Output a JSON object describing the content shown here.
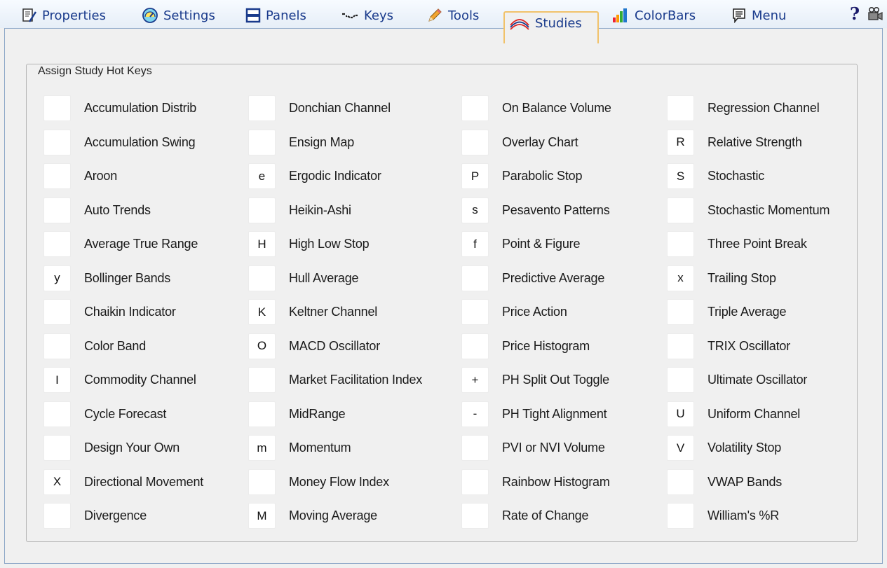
{
  "toolbar": {
    "tabs": [
      {
        "id": "properties",
        "label": "Properties",
        "icon": "properties-icon"
      },
      {
        "id": "settings",
        "label": "Settings",
        "icon": "settings-icon"
      },
      {
        "id": "panels",
        "label": "Panels",
        "icon": "panels-icon"
      },
      {
        "id": "keys",
        "label": "Keys",
        "icon": "keys-icon"
      },
      {
        "id": "tools",
        "label": "Tools",
        "icon": "pencil-icon"
      },
      {
        "id": "studies",
        "label": "Studies",
        "icon": "studies-icon",
        "active": true
      },
      {
        "id": "colorbars",
        "label": "ColorBars",
        "icon": "bar-chart-icon"
      },
      {
        "id": "menu",
        "label": "Menu",
        "icon": "menu-icon"
      }
    ],
    "help_label": "?",
    "accent": "#1a3b8c",
    "active_border": "#f1c26a"
  },
  "group": {
    "title": "Assign Study Hot Keys"
  },
  "columns": [
    [
      {
        "key": "",
        "label": "Accumulation Distrib"
      },
      {
        "key": "",
        "label": "Accumulation Swing"
      },
      {
        "key": "",
        "label": "Aroon"
      },
      {
        "key": "",
        "label": "Auto Trends"
      },
      {
        "key": "",
        "label": "Average True Range"
      },
      {
        "key": "y",
        "label": "Bollinger Bands"
      },
      {
        "key": "",
        "label": "Chaikin Indicator"
      },
      {
        "key": "",
        "label": "Color Band"
      },
      {
        "key": "I",
        "label": "Commodity Channel"
      },
      {
        "key": "",
        "label": "Cycle Forecast"
      },
      {
        "key": "",
        "label": "Design Your Own"
      },
      {
        "key": "X",
        "label": "Directional Movement"
      },
      {
        "key": "",
        "label": "Divergence"
      }
    ],
    [
      {
        "key": "",
        "label": "Donchian Channel"
      },
      {
        "key": "",
        "label": "Ensign Map"
      },
      {
        "key": "e",
        "label": "Ergodic Indicator"
      },
      {
        "key": "",
        "label": "Heikin-Ashi"
      },
      {
        "key": "H",
        "label": "High Low Stop"
      },
      {
        "key": "",
        "label": "Hull Average"
      },
      {
        "key": "K",
        "label": "Keltner Channel"
      },
      {
        "key": "O",
        "label": "MACD Oscillator"
      },
      {
        "key": "",
        "label": "Market Facilitation Index"
      },
      {
        "key": "",
        "label": "MidRange"
      },
      {
        "key": "m",
        "label": "Momentum"
      },
      {
        "key": "",
        "label": "Money Flow Index"
      },
      {
        "key": "M",
        "label": "Moving Average"
      }
    ],
    [
      {
        "key": "",
        "label": "On Balance Volume"
      },
      {
        "key": "",
        "label": "Overlay Chart"
      },
      {
        "key": "P",
        "label": "Parabolic Stop"
      },
      {
        "key": "s",
        "label": "Pesavento Patterns"
      },
      {
        "key": "f",
        "label": "Point & Figure"
      },
      {
        "key": "",
        "label": "Predictive Average"
      },
      {
        "key": "",
        "label": "Price Action"
      },
      {
        "key": "",
        "label": "Price Histogram"
      },
      {
        "key": "+",
        "label": "PH Split Out Toggle"
      },
      {
        "key": "-",
        "label": "PH Tight Alignment"
      },
      {
        "key": "",
        "label": "PVI or NVI Volume"
      },
      {
        "key": "",
        "label": "Rainbow Histogram"
      },
      {
        "key": "",
        "label": "Rate of Change"
      }
    ],
    [
      {
        "key": "",
        "label": "Regression Channel"
      },
      {
        "key": "R",
        "label": "Relative Strength"
      },
      {
        "key": "S",
        "label": "Stochastic"
      },
      {
        "key": "",
        "label": "Stochastic Momentum"
      },
      {
        "key": "",
        "label": "Three Point Break"
      },
      {
        "key": "x",
        "label": "Trailing Stop"
      },
      {
        "key": "",
        "label": "Triple Average"
      },
      {
        "key": "",
        "label": "TRIX Oscillator"
      },
      {
        "key": "",
        "label": "Ultimate Oscillator"
      },
      {
        "key": "U",
        "label": "Uniform Channel"
      },
      {
        "key": "V",
        "label": "Volatility Stop"
      },
      {
        "key": "",
        "label": "VWAP Bands"
      },
      {
        "key": "",
        "label": "William's %R"
      }
    ]
  ]
}
